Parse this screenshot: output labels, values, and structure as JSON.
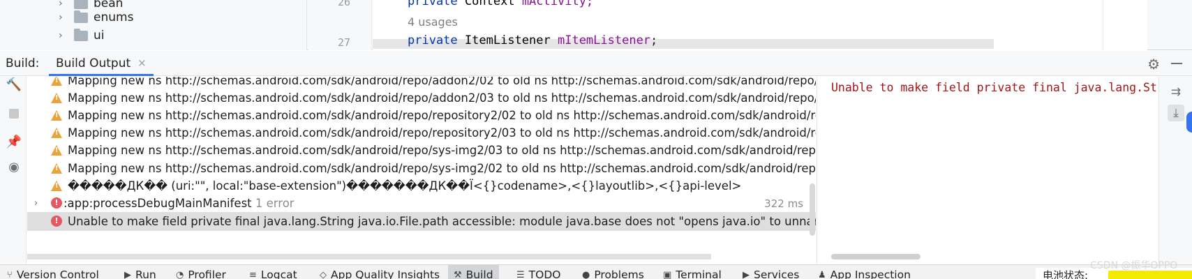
{
  "tree": {
    "items": [
      {
        "label": "bean"
      },
      {
        "label": "enums"
      },
      {
        "label": "ui"
      }
    ]
  },
  "editor": {
    "line1_no": "26",
    "line1_kw": "private",
    "line1_type": "Context",
    "line1_field": "mActivity;",
    "usages": "4 usages",
    "line2_no": "27",
    "line2_kw": "private",
    "line2_type": "ItemListener",
    "line2_field": "mItemListener",
    "line2_end": ";"
  },
  "build_window": {
    "title": "Build:",
    "tab_label": "Build Output",
    "tab_close": "×"
  },
  "build_rows": [
    {
      "kind": "warning",
      "text": "Mapping new ns http://schemas.android.com/sdk/android/repo/addon2/02 to old ns http://schemas.android.com/sdk/android/repo/"
    },
    {
      "kind": "warning",
      "text": "Mapping new ns http://schemas.android.com/sdk/android/repo/addon2/03 to old ns http://schemas.android.com/sdk/android/repo/"
    },
    {
      "kind": "warning",
      "text": "Mapping new ns http://schemas.android.com/sdk/android/repo/repository2/02 to old ns http://schemas.android.com/sdk/android/re"
    },
    {
      "kind": "warning",
      "text": "Mapping new ns http://schemas.android.com/sdk/android/repo/repository2/03 to old ns http://schemas.android.com/sdk/android/re"
    },
    {
      "kind": "warning",
      "text": "Mapping new ns http://schemas.android.com/sdk/android/repo/sys-img2/03 to old ns http://schemas.android.com/sdk/android/repo"
    },
    {
      "kind": "warning",
      "text": "Mapping new ns http://schemas.android.com/sdk/android/repo/sys-img2/02 to old ns http://schemas.android.com/sdk/android/repo"
    },
    {
      "kind": "warning",
      "text": "�����ДК�� (uri:\"\", local:\"base-extension\")�������ДК��Ї<{}codename>,<{}layoutlib>,<{}api-level>"
    }
  ],
  "task_row": {
    "label": ":app:processDebugMainManifest",
    "count": "1 error",
    "time": "322 ms"
  },
  "error_row": {
    "text": "Unable to make field private final java.lang.String java.io.File.path accessible: module java.base does not \"opens java.io\" to unnamed m"
  },
  "details": {
    "text": "Unable to make field private final java.lang.String java.io.File.path accessible"
  },
  "bottom_tabs": [
    {
      "label": "Version Control"
    },
    {
      "label": "Run"
    },
    {
      "label": "Profiler"
    },
    {
      "label": "Logcat"
    },
    {
      "label": "App Quality Insights"
    },
    {
      "label": "Build"
    },
    {
      "label": "TODO"
    },
    {
      "label": "Problems"
    },
    {
      "label": "Terminal"
    },
    {
      "label": "Services"
    },
    {
      "label": "App Inspection"
    }
  ],
  "status": {
    "text": "电池状态:"
  },
  "watermark": "CSDN @振华OPPO",
  "colors": {
    "accent": "#3574f0",
    "warning": "#e8a33a",
    "error": "#e55765",
    "console_error_text": "#a31515"
  }
}
